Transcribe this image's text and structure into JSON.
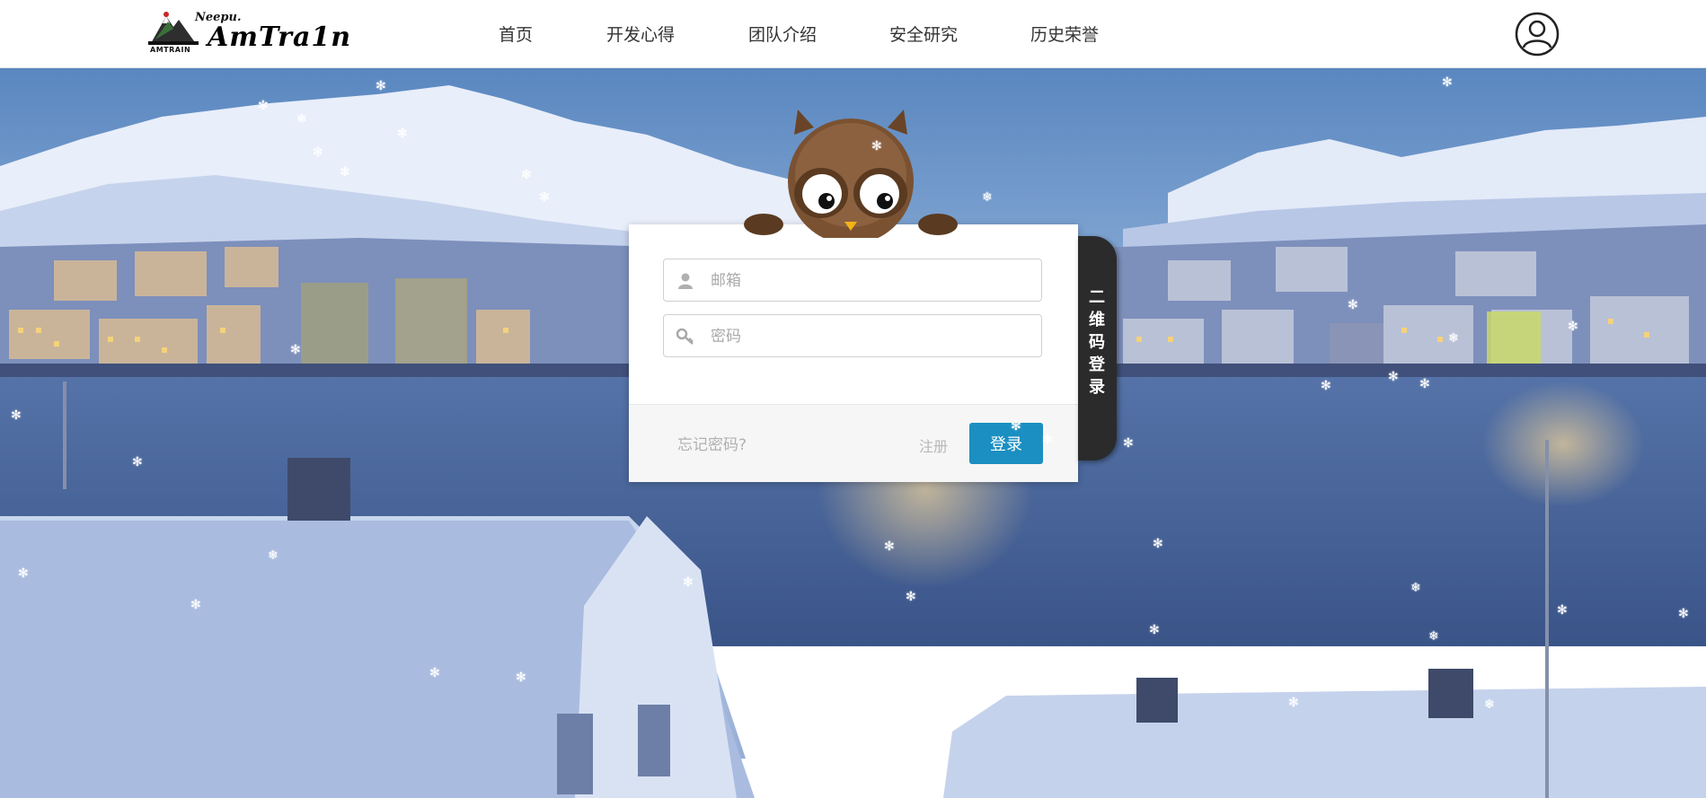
{
  "logo": {
    "small_text": "Neepu.",
    "big_text": "AmTra1n",
    "sub_text": "AMTRAIN"
  },
  "nav": {
    "items": [
      "首页",
      "开发心得",
      "团队介绍",
      "安全研究",
      "历史荣誉"
    ]
  },
  "login": {
    "email_placeholder": "邮箱",
    "password_placeholder": "密码",
    "forgot_label": "忘记密码?",
    "register_label": "注册",
    "submit_label": "登录"
  },
  "qr_tab": {
    "label": "二维码登录"
  },
  "icons": {
    "user": "user-circle-icon",
    "email": "user-icon",
    "password": "key-icon",
    "snow": "snowflake-icon"
  },
  "colors": {
    "accent": "#1b8fc1",
    "header_bg": "#ffffff",
    "qr_tab_bg": "#2b2b2b",
    "owl_brown": "#7a5232"
  }
}
